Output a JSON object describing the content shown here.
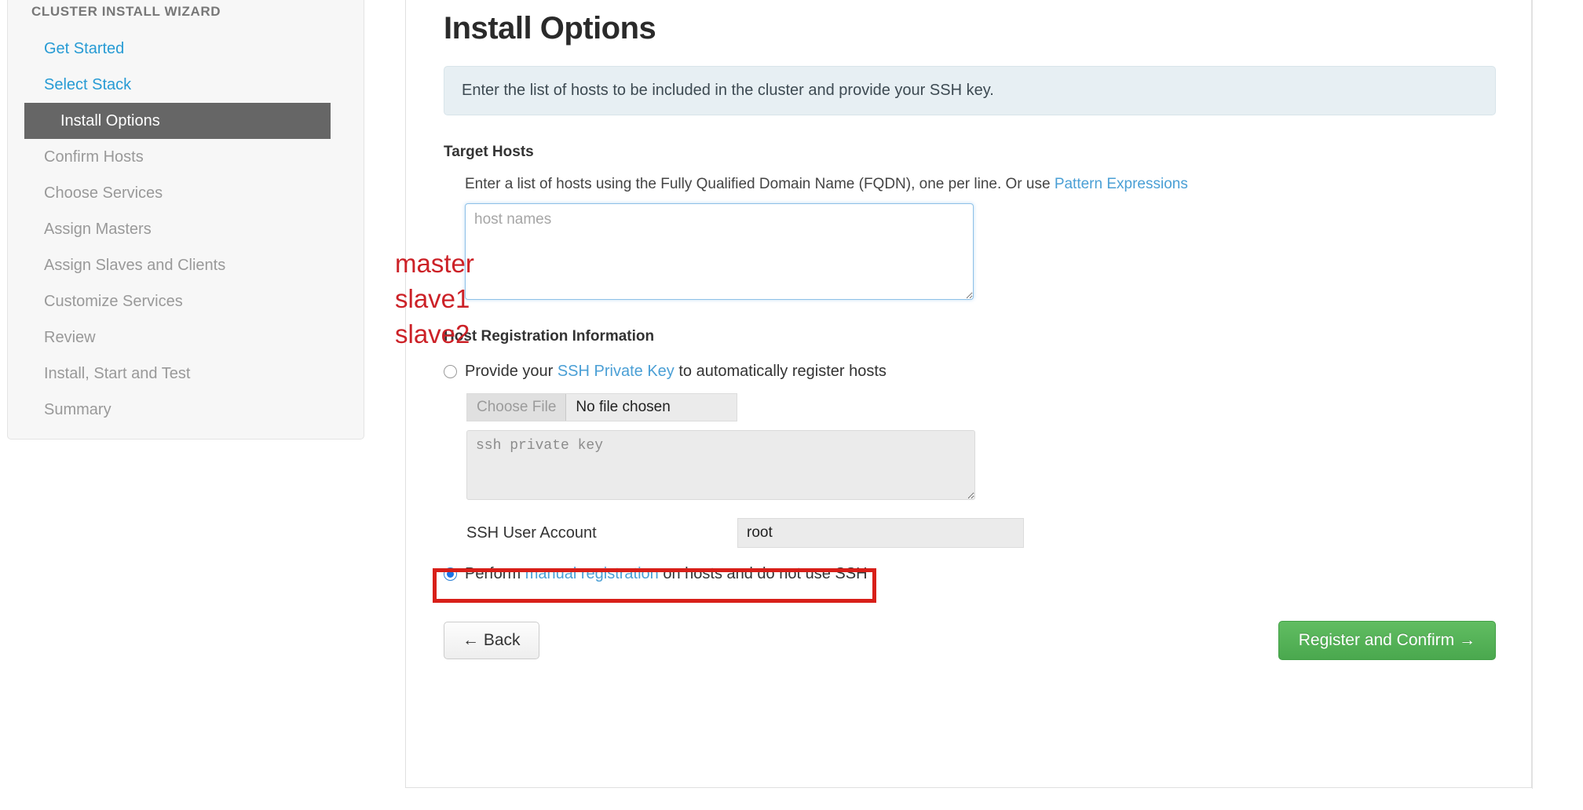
{
  "sidebar": {
    "title": "CLUSTER INSTALL WIZARD",
    "items": [
      {
        "label": "Get Started",
        "state": "link"
      },
      {
        "label": "Select Stack",
        "state": "link"
      },
      {
        "label": "Install Options",
        "state": "active"
      },
      {
        "label": "Confirm Hosts",
        "state": "disabled"
      },
      {
        "label": "Choose Services",
        "state": "disabled"
      },
      {
        "label": "Assign Masters",
        "state": "disabled"
      },
      {
        "label": "Assign Slaves and Clients",
        "state": "disabled"
      },
      {
        "label": "Customize Services",
        "state": "disabled"
      },
      {
        "label": "Review",
        "state": "disabled"
      },
      {
        "label": "Install, Start and Test",
        "state": "disabled"
      },
      {
        "label": "Summary",
        "state": "disabled"
      }
    ]
  },
  "main": {
    "title": "Install Options",
    "info_banner": "Enter the list of hosts to be included in the cluster and provide your SSH key.",
    "target_hosts": {
      "heading": "Target Hosts",
      "help_prefix": "Enter a list of hosts using the Fully Qualified Domain Name (FQDN), one per line. Or use ",
      "help_link": "Pattern Expressions",
      "textarea_placeholder": "host names",
      "textarea_value": "",
      "annotation_lines": [
        "master",
        "slave1",
        "slave2"
      ],
      "annotation_color": "#cc2127"
    },
    "host_registration": {
      "heading": "Host Registration Information",
      "ssh_option": {
        "prefix": "Provide your ",
        "link": "SSH Private Key",
        "suffix": " to automatically register hosts",
        "selected": false
      },
      "file_chooser": {
        "button_label": "Choose File",
        "status_label": "No file chosen"
      },
      "ssh_key_placeholder": "ssh private key",
      "ssh_key_value": "",
      "ssh_user": {
        "label": "SSH User Account",
        "value": "root"
      },
      "manual_option": {
        "prefix": "Perform ",
        "link": "manual registration",
        "suffix": " on hosts and do not use SSH",
        "selected": true,
        "highlight_color": "#d81f19"
      }
    },
    "buttons": {
      "back": "← Back",
      "confirm": "Register and Confirm →",
      "confirm_color": "#4aa84e"
    }
  }
}
